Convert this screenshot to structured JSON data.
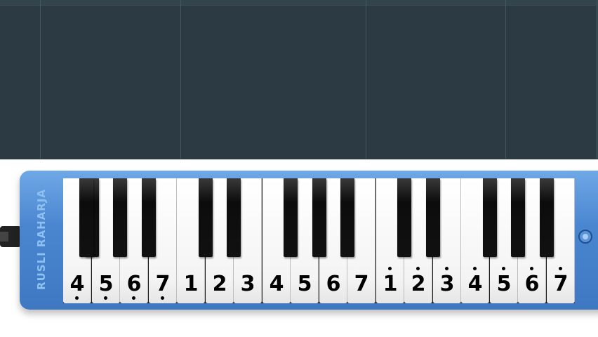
{
  "timeline": {
    "background": "#2c3b43",
    "gridline_color": "#44565f"
  },
  "melodica": {
    "brand_text": "RUSLI RAHARJA",
    "body_color": "#4a86d0",
    "white_keys": [
      {
        "label": "4",
        "octave": "low"
      },
      {
        "label": "5",
        "octave": "low"
      },
      {
        "label": "6",
        "octave": "low"
      },
      {
        "label": "7",
        "octave": "low"
      },
      {
        "label": "1",
        "octave": "mid"
      },
      {
        "label": "2",
        "octave": "mid"
      },
      {
        "label": "3",
        "octave": "mid"
      },
      {
        "label": "4",
        "octave": "mid"
      },
      {
        "label": "5",
        "octave": "mid"
      },
      {
        "label": "6",
        "octave": "mid"
      },
      {
        "label": "7",
        "octave": "mid"
      },
      {
        "label": "1",
        "octave": "high"
      },
      {
        "label": "2",
        "octave": "high"
      },
      {
        "label": "3",
        "octave": "high"
      },
      {
        "label": "4",
        "octave": "high"
      },
      {
        "label": "5",
        "octave": "high"
      },
      {
        "label": "6",
        "octave": "high"
      },
      {
        "label": "7",
        "octave": "high"
      }
    ]
  }
}
